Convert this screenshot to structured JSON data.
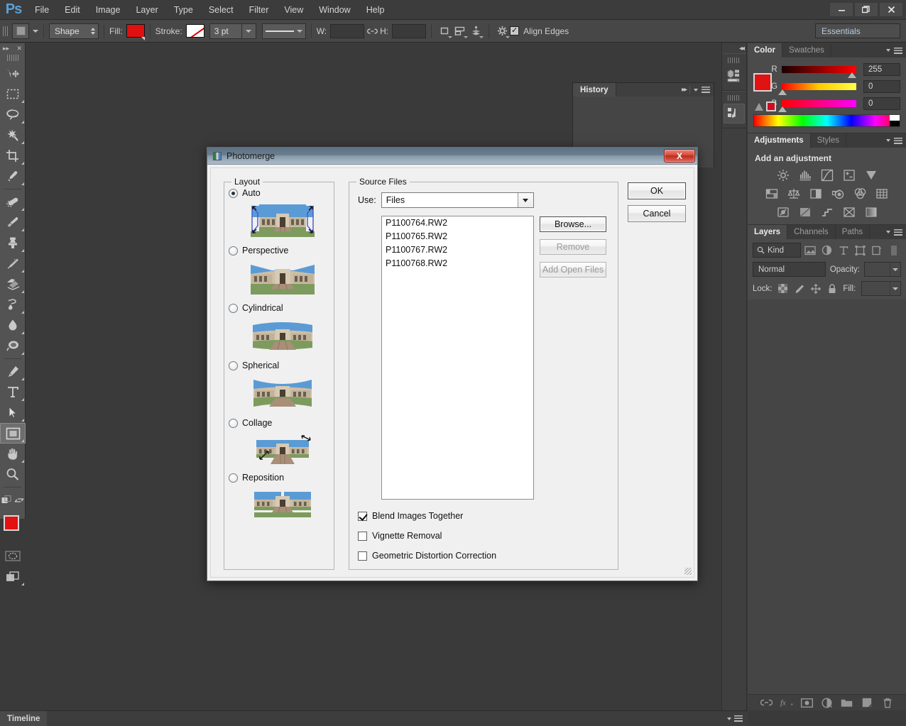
{
  "app": {
    "name": "Adobe Photoshop",
    "logo_text": "Ps"
  },
  "menubar": {
    "items": [
      {
        "label": "File"
      },
      {
        "label": "Edit"
      },
      {
        "label": "Image"
      },
      {
        "label": "Layer"
      },
      {
        "label": "Type"
      },
      {
        "label": "Select"
      },
      {
        "label": "Filter"
      },
      {
        "label": "View"
      },
      {
        "label": "Window"
      },
      {
        "label": "Help"
      }
    ],
    "window_controls": {
      "minimize": "—",
      "restore": "❐",
      "close": "✕"
    }
  },
  "options_bar": {
    "tool_mode": "Shape",
    "fill_label": "Fill:",
    "fill_color": "#e01010",
    "stroke_label": "Stroke:",
    "stroke_weight": "3 pt",
    "width_label": "W:",
    "width_value": "",
    "height_label": "H:",
    "height_value": "",
    "align_edges_label": "Align Edges",
    "align_edges_checked": true,
    "workspace": "Essentials"
  },
  "toolbar": {
    "collapse_icon": "▸▸",
    "close_icon": "✕",
    "tools": [
      {
        "name": "move-tool",
        "selected": false
      },
      {
        "name": "rectangular-marquee-tool",
        "selected": false
      },
      {
        "name": "lasso-tool",
        "selected": false
      },
      {
        "name": "quick-selection-tool",
        "selected": false
      },
      {
        "name": "crop-tool",
        "selected": false
      },
      {
        "name": "eyedropper-tool",
        "selected": false
      },
      {
        "name": "spot-healing-brush-tool",
        "selected": false
      },
      {
        "name": "brush-tool",
        "selected": false
      },
      {
        "name": "clone-stamp-tool",
        "selected": false
      },
      {
        "name": "history-brush-tool",
        "selected": false
      },
      {
        "name": "eraser-tool",
        "selected": false
      },
      {
        "name": "gradient-tool",
        "selected": false
      },
      {
        "name": "blur-tool",
        "selected": false
      },
      {
        "name": "dodge-tool",
        "selected": false
      },
      {
        "name": "pen-tool",
        "selected": false
      },
      {
        "name": "type-tool",
        "selected": false
      },
      {
        "name": "path-selection-tool",
        "selected": false
      },
      {
        "name": "rectangle-shape-tool",
        "selected": true
      },
      {
        "name": "hand-tool",
        "selected": false
      },
      {
        "name": "zoom-tool",
        "selected": false
      }
    ],
    "foreground_color": "#e21212",
    "background_color": "#cf00cf"
  },
  "history_panel": {
    "tab_label": "History",
    "expand_icon": "▸▸"
  },
  "dock_rail": {
    "collapse_icon": "◂◂",
    "icons": [
      {
        "name": "mini-bridge-icon"
      },
      {
        "name": "history-actions-icon"
      }
    ]
  },
  "color_panel": {
    "tabs": [
      {
        "label": "Color",
        "active": true
      },
      {
        "label": "Swatches",
        "active": false
      }
    ],
    "channels": [
      {
        "letter": "R",
        "value": "255",
        "thumb_pct": 100
      },
      {
        "letter": "G",
        "value": "0",
        "thumb_pct": 0
      },
      {
        "letter": "B",
        "value": "0",
        "thumb_pct": 0
      }
    ],
    "foreground_color": "#e01212",
    "background_color": "#e000e0",
    "out_of_gamut_color": "#d10b20"
  },
  "adjustments_panel": {
    "tabs": [
      {
        "label": "Adjustments",
        "active": true
      },
      {
        "label": "Styles",
        "active": false
      }
    ],
    "heading": "Add an adjustment",
    "rows": [
      [
        {
          "name": "brightness-contrast-icon"
        },
        {
          "name": "levels-icon"
        },
        {
          "name": "curves-icon"
        },
        {
          "name": "exposure-icon"
        },
        {
          "name": "vibrance-icon"
        }
      ],
      [
        {
          "name": "hue-saturation-icon"
        },
        {
          "name": "color-balance-icon"
        },
        {
          "name": "black-white-icon"
        },
        {
          "name": "photo-filter-icon"
        },
        {
          "name": "channel-mixer-icon"
        },
        {
          "name": "color-lookup-icon"
        }
      ],
      [
        {
          "name": "invert-icon"
        },
        {
          "name": "posterize-icon"
        },
        {
          "name": "threshold-icon"
        },
        {
          "name": "selective-color-icon"
        },
        {
          "name": "gradient-map-icon"
        }
      ]
    ]
  },
  "layers_panel": {
    "tabs": [
      {
        "label": "Layers",
        "active": true
      },
      {
        "label": "Channels",
        "active": false
      },
      {
        "label": "Paths",
        "active": false
      }
    ],
    "filter_label": "Kind",
    "filter_icons": [
      {
        "name": "filter-pixel-icon"
      },
      {
        "name": "filter-adjustment-icon"
      },
      {
        "name": "filter-type-icon"
      },
      {
        "name": "filter-shape-icon"
      },
      {
        "name": "filter-smart-object-icon"
      }
    ],
    "blend_mode": "Normal",
    "opacity_label": "Opacity:",
    "opacity_value": "",
    "lock_label": "Lock:",
    "fill_label": "Fill:",
    "fill_value": "",
    "lock_icons": [
      {
        "name": "lock-transparency-icon"
      },
      {
        "name": "lock-image-icon"
      },
      {
        "name": "lock-position-icon"
      },
      {
        "name": "lock-all-icon"
      }
    ],
    "footer_icons": [
      {
        "name": "link-layers-icon"
      },
      {
        "name": "layer-style-fx-icon"
      },
      {
        "name": "add-layer-mask-icon"
      },
      {
        "name": "new-adjustment-layer-icon"
      },
      {
        "name": "new-group-icon"
      },
      {
        "name": "new-layer-icon"
      },
      {
        "name": "delete-layer-icon"
      }
    ]
  },
  "status_bar": {
    "tab_label": "Timeline"
  },
  "dialog": {
    "title": "Photomerge",
    "close_label": "X",
    "layout": {
      "legend": "Layout",
      "options": [
        {
          "label": "Auto",
          "selected": true,
          "thumb": "auto"
        },
        {
          "label": "Perspective",
          "selected": false,
          "thumb": "perspective"
        },
        {
          "label": "Cylindrical",
          "selected": false,
          "thumb": "cylindrical"
        },
        {
          "label": "Spherical",
          "selected": false,
          "thumb": "spherical"
        },
        {
          "label": "Collage",
          "selected": false,
          "thumb": "collage"
        },
        {
          "label": "Reposition",
          "selected": false,
          "thumb": "reposition"
        }
      ]
    },
    "source_files": {
      "legend": "Source Files",
      "use_label": "Use:",
      "use_value": "Files",
      "files": [
        "P1100764.RW2",
        "P1100765.RW2",
        "P1100767.RW2",
        "P1100768.RW2"
      ],
      "buttons": [
        {
          "label": "Browse...",
          "name": "browse-button",
          "disabled": false
        },
        {
          "label": "Remove",
          "name": "remove-button",
          "disabled": true
        },
        {
          "label": "Add Open Files",
          "name": "add-open-files-button",
          "disabled": true
        }
      ]
    },
    "checkboxes": [
      {
        "label": "Blend Images Together",
        "checked": true,
        "name": "blend-images-together-checkbox"
      },
      {
        "label": "Vignette Removal",
        "checked": false,
        "name": "vignette-removal-checkbox"
      },
      {
        "label": "Geometric Distortion Correction",
        "checked": false,
        "name": "geometric-distortion-correction-checkbox"
      }
    ],
    "actions": [
      {
        "label": "OK",
        "name": "ok-button",
        "primary": true
      },
      {
        "label": "Cancel",
        "name": "cancel-button",
        "primary": false
      }
    ]
  }
}
